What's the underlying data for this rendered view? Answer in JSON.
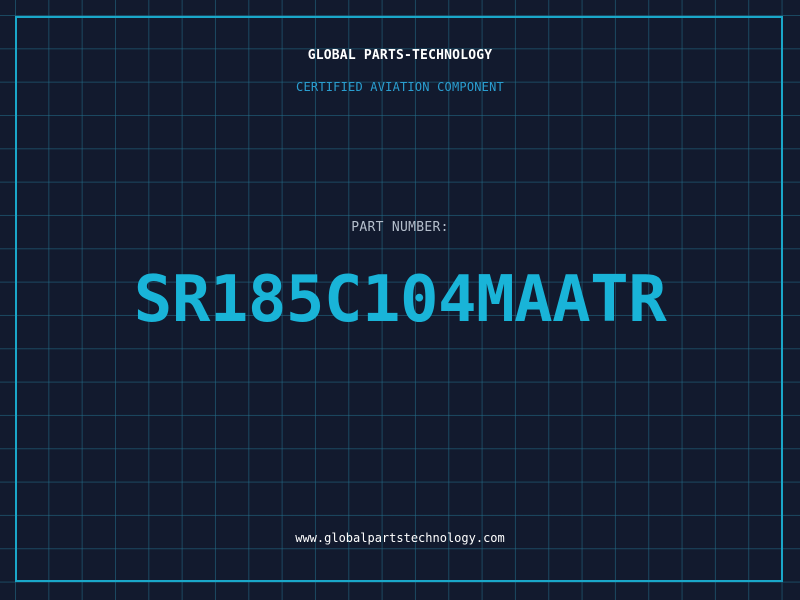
{
  "header": {
    "title": "GLOBAL PARTS-TECHNOLOGY",
    "subtitle": "CERTIFIED AVIATION COMPONENT"
  },
  "part": {
    "label": "PART NUMBER:",
    "number": "SR185C104MAATR"
  },
  "footer": {
    "url": "www.globalpartstechnology.com"
  },
  "colors": {
    "background": "#121a2e",
    "grid": "#236e8a",
    "accent": "#1aa7c9",
    "text_primary": "#ffffff",
    "text_secondary": "#b5bfcc"
  }
}
